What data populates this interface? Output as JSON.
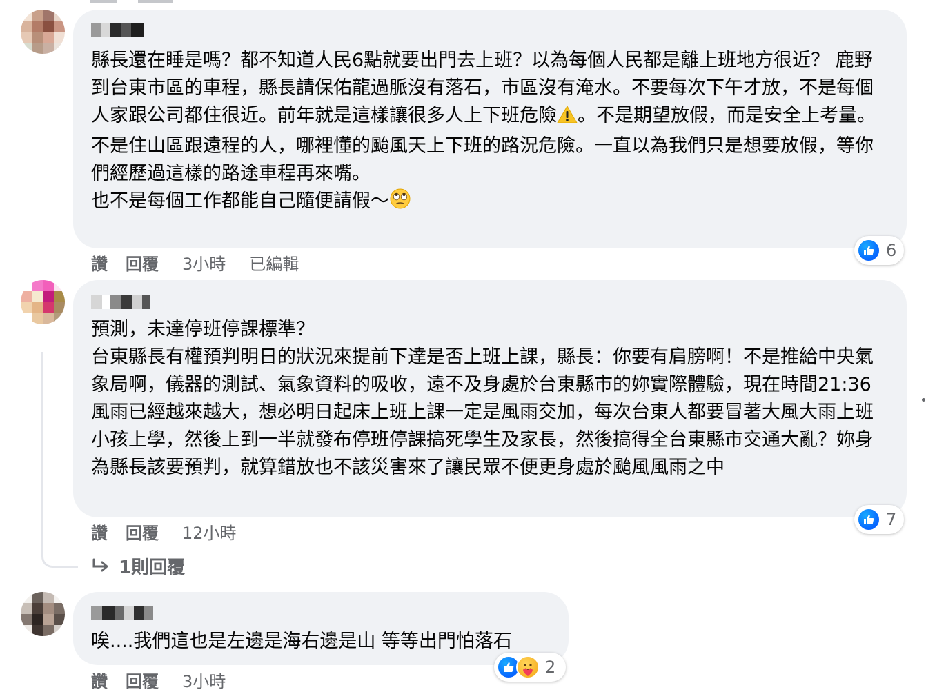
{
  "comments": [
    {
      "text_part1": "縣長還在睡是嗎？都不知道人民6點就要出門去上班？以為每個人民都是離上班地方很近？ 鹿野到台東市區的車程，縣長請保佑龍過脈沒有落石，市區沒有淹水。不要每次下午才放，不是每個人家跟公司都住很近。前年就是這樣讓很多人上下班危險",
      "warning_emoji": "⚠️",
      "text_part2": "。不是期望放假，而是安全上考量。\n不是住山區跟遠程的人，哪裡懂的颱風天上下班的路況危險。一直以為我們只是想要放假，等你們經歷過這樣的路途車程再來嘴。\n也不是每個工作都能自己隨便請假～",
      "rolling_eyes_emoji": "🙄",
      "like_label": "讚",
      "reply_label": "回覆",
      "time": "3小時",
      "edited": "已編輯",
      "reaction_count": "6",
      "reaction_icons": [
        "like-icon"
      ]
    },
    {
      "text": "預測，未達停班停課標準？\n台東縣長有權預判明日的狀況來提前下達是否上班上課，縣長：你要有肩膀啊！不是推給中央氣象局啊，儀器的測試、氣象資料的吸收，遠不及身處於台東縣市的妳實際體驗，現在時間21:36風雨已經越來越大，想必明日起床上班上課一定是風雨交加，每次台東人都要冒著大風大雨上班小孩上學，然後上到一半就發布停班停課搞死學生及家長，然後搞得全台東縣市交通大亂？妳身為縣長該要預判，就算錯放也不該災害來了讓民眾不便更身處於颱風風雨之中",
      "like_label": "讚",
      "reply_label": "回覆",
      "time": "12小時",
      "reaction_count": "7",
      "reaction_icons": [
        "like-icon"
      ],
      "replies_label": "1則回覆"
    },
    {
      "text": "唉....我們這也是左邊是海右邊是山 等等出門怕落石",
      "like_label": "讚",
      "reply_label": "回覆",
      "time": "3小時",
      "reaction_count": "2",
      "reaction_icons": [
        "like-icon",
        "care-icon"
      ]
    }
  ],
  "colors": {
    "bubble_bg": "#f0f2f5",
    "meta_text": "#65676b",
    "like_blue": "#0866ff",
    "text": "#050505"
  }
}
